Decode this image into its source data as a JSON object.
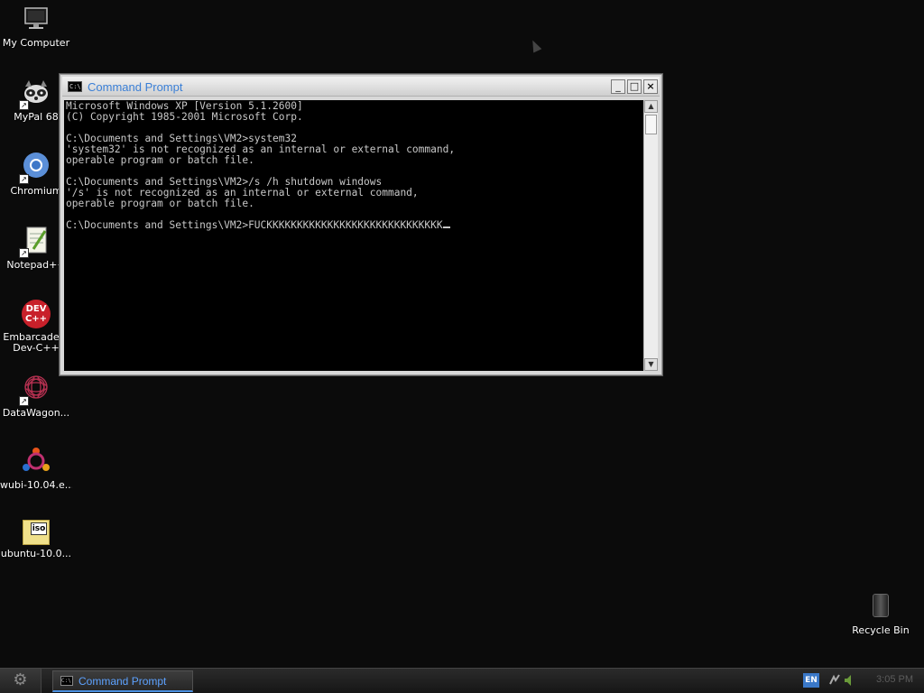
{
  "desktop_icons": [
    {
      "label": "My Computer",
      "icon": "monitor-icon"
    },
    {
      "label": "MyPal 68",
      "icon": "raccoon-icon"
    },
    {
      "label": "Chromium",
      "icon": "chromium-icon"
    },
    {
      "label": "Notepad++",
      "icon": "notepad-icon"
    },
    {
      "label": "Embarcadero Dev-C++",
      "icon_text": "DEV C++",
      "icon": "devcpp-icon"
    },
    {
      "label": "DataWagon...",
      "icon": "datawagon-icon"
    },
    {
      "label": "wubi-10.04.e...",
      "icon": "ubuntu-icon"
    },
    {
      "label": "ubuntu-10.0...",
      "icon_text": "iso",
      "icon": "iso-file-icon"
    }
  ],
  "window": {
    "title": "Command Prompt",
    "icon_text": "C:\\",
    "minimize": "_",
    "maximize": "□",
    "close": "×",
    "console_text": "Microsoft Windows XP [Version 5.1.2600]\n(C) Copyright 1985-2001 Microsoft Corp.\n\nC:\\Documents and Settings\\VM2>system32\n'system32' is not recognized as an internal or external command,\noperable program or batch file.\n\nC:\\Documents and Settings\\VM2>/s /h shutdown windows\n'/s' is not recognized as an internal or external command,\noperable program or batch file.\n\nC:\\Documents and Settings\\VM2>FUCKKKKKKKKKKKKKKKKKKKKKKKKKKKKK",
    "scroll_up": "▲",
    "scroll_down": "▼"
  },
  "recycle_bin": {
    "label": "Recycle Bin"
  },
  "taskbar": {
    "start_icon": "⚙",
    "task_label": "Command Prompt",
    "task_icon_text": "C:\\",
    "language": "EN",
    "clock": "3:05 PM",
    "tray_icons": [
      "network-icon",
      "speaker-icon"
    ]
  },
  "colors": {
    "title_text": "#3a7fd6",
    "console_bg": "#000000",
    "console_fg": "#c8c8c8",
    "task_accent": "#4a8fe0"
  }
}
